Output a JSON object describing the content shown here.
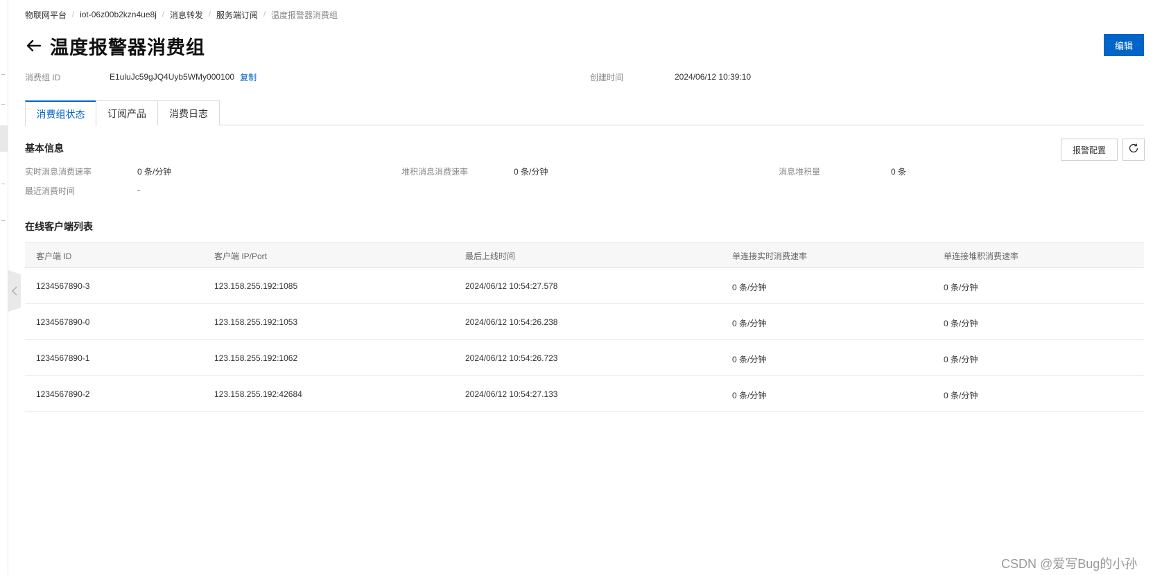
{
  "breadcrumb": {
    "items": [
      "物联网平台",
      "iot-06z00b2kzn4ue8j",
      "消息转发",
      "服务端订阅"
    ],
    "current": "温度报警器消费组"
  },
  "page": {
    "title": "温度报警器消费组",
    "edit_label": "编辑"
  },
  "meta": {
    "group_id_label": "消费组 ID",
    "group_id_value": "E1uluJc59gJQ4Uyb5WMy000100",
    "copy_label": "复制",
    "created_label": "创建时间",
    "created_value": "2024/06/12 10:39:10"
  },
  "tabs": [
    {
      "label": "消费组状态",
      "active": true
    },
    {
      "label": "订阅产品",
      "active": false
    },
    {
      "label": "消费日志",
      "active": false
    }
  ],
  "basic_info": {
    "title": "基本信息",
    "alarm_config_label": "报警配置",
    "items": [
      {
        "label": "实时消息消费速率",
        "value": "0 条/分钟"
      },
      {
        "label": "堆积消息消费速率",
        "value": "0 条/分钟"
      },
      {
        "label": "消息堆积量",
        "value": "0 条"
      },
      {
        "label": "最近消费时间",
        "value": "-"
      }
    ]
  },
  "clients": {
    "title": "在线客户端列表",
    "columns": [
      "客户端 ID",
      "客户端 IP/Port",
      "最后上线时间",
      "单连接实时消费速率",
      "单连接堆积消费速率"
    ],
    "rows": [
      [
        "1234567890-3",
        "123.158.255.192:1085",
        "2024/06/12 10:54:27.578",
        "0 条/分钟",
        "0 条/分钟"
      ],
      [
        "1234567890-0",
        "123.158.255.192:1053",
        "2024/06/12 10:54:26.238",
        "0 条/分钟",
        "0 条/分钟"
      ],
      [
        "1234567890-1",
        "123.158.255.192:1062",
        "2024/06/12 10:54:26.723",
        "0 条/分钟",
        "0 条/分钟"
      ],
      [
        "1234567890-2",
        "123.158.255.192:42684",
        "2024/06/12 10:54:27.133",
        "0 条/分钟",
        "0 条/分钟"
      ]
    ]
  },
  "watermark": "CSDN @爱写Bug的小孙",
  "icons": {
    "back": "arrow-left-icon",
    "refresh": "refresh-icon",
    "collapse": "chevron-left-icon"
  },
  "colors": {
    "primary": "#0064c8"
  }
}
